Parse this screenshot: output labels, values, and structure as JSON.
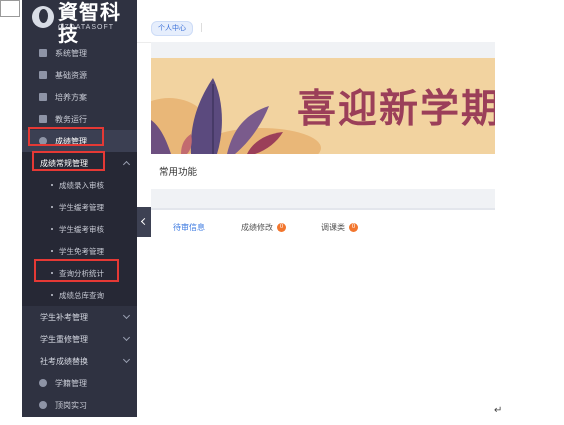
{
  "sidebar": {
    "logo_name": "資智科技",
    "logo_sub": "QZDATASOFT",
    "items": [
      {
        "label": "系统管理",
        "icon": "grid-icon"
      },
      {
        "label": "基础资源",
        "icon": "flag-icon"
      },
      {
        "label": "培养方案",
        "icon": "book-icon"
      },
      {
        "label": "教务运行",
        "icon": "monitor-icon"
      },
      {
        "label": "成绩管理",
        "icon": "award-icon"
      }
    ],
    "groups": [
      {
        "label": "成绩常规管理"
      },
      {
        "label": "学生补考管理"
      },
      {
        "label": "学生重修管理"
      },
      {
        "label": "社考成绩替换"
      }
    ],
    "subitems": [
      "成绩录入审核",
      "学生缓考管理",
      "学生缓考审核",
      "学生免考管理",
      "查询分析统计",
      "成绩总库查询"
    ],
    "bottom_items": [
      {
        "label": "学籍管理",
        "icon": "settings-icon"
      },
      {
        "label": "顶岗实习",
        "icon": "location-icon"
      }
    ]
  },
  "topbar": {
    "tag": "个人中心"
  },
  "banner": {
    "text": "喜迎新学期"
  },
  "card": {
    "title": "常用功能"
  },
  "tabs": [
    {
      "label": "待审信息",
      "active": true
    },
    {
      "label": "成绩修改",
      "count": "0"
    },
    {
      "label": "调课类",
      "count": "0"
    }
  ],
  "misc": {
    "return_mark": "↵"
  },
  "colors": {
    "sidebar": "#2f3241",
    "accent": "#3a78e0",
    "highlight": "#e53935",
    "badge": "#f2762e"
  }
}
